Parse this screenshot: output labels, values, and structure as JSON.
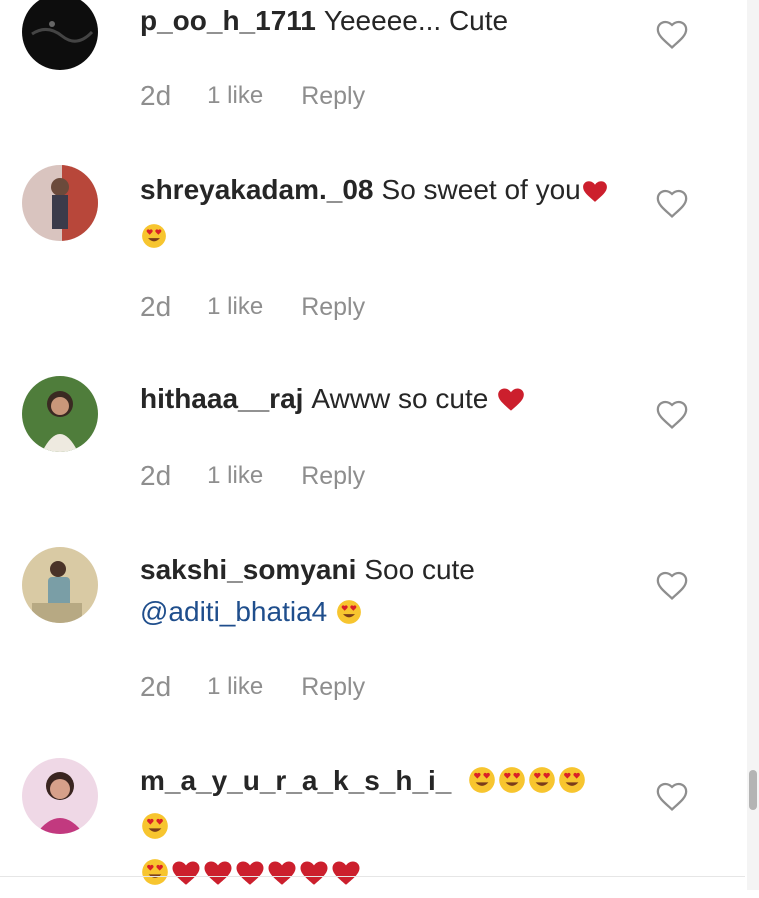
{
  "comments": [
    {
      "username": "p_oo_h_1711",
      "text": "Yeeeee... Cute",
      "time": "2d",
      "likes": "1 like",
      "reply": "Reply",
      "avatar_colors": [
        "#111111",
        "#333333"
      ]
    },
    {
      "username": "shreyakadam._08",
      "text": "So sweet of you",
      "emojis": [
        "red-heart",
        "smiling-face-heart-eyes"
      ],
      "time": "2d",
      "likes": "1 like",
      "reply": "Reply",
      "avatar_colors": [
        "#c9a9a2",
        "#b35a4a"
      ]
    },
    {
      "username": "hithaaa__raj",
      "text": "Awww so cute",
      "emojis": [
        "red-heart"
      ],
      "time": "2d",
      "likes": "1 like",
      "reply": "Reply",
      "avatar_colors": [
        "#4d7a3a",
        "#e9e6dc"
      ]
    },
    {
      "username": "sakshi_somyani",
      "text": "Soo cute",
      "mention": "@aditi_bhatia4",
      "emojis": [
        "smiling-face-heart-eyes"
      ],
      "time": "2d",
      "likes": "1 like",
      "reply": "Reply",
      "avatar_colors": [
        "#d8c9a3",
        "#6d8e9a"
      ]
    },
    {
      "username": "m_a_y_u_r_a_k_s_h_i_",
      "text": "",
      "emojis": [
        "smiling-face-heart-eyes",
        "smiling-face-heart-eyes",
        "smiling-face-heart-eyes",
        "smiling-face-heart-eyes",
        "smiling-face-heart-eyes",
        "smiling-face-heart-eyes",
        "red-heart",
        "red-heart",
        "red-heart",
        "red-heart",
        "red-heart",
        "red-heart"
      ],
      "avatar_colors": [
        "#e8a0c8",
        "#c2397f"
      ]
    }
  ],
  "icons": {
    "like": "heart-outline-icon"
  },
  "colors": {
    "username": "#262626",
    "meta": "#8e8e8e",
    "mention": "#1f4e8c",
    "heart": "#cc1f2d",
    "emoji_face": "#f7c52f"
  }
}
